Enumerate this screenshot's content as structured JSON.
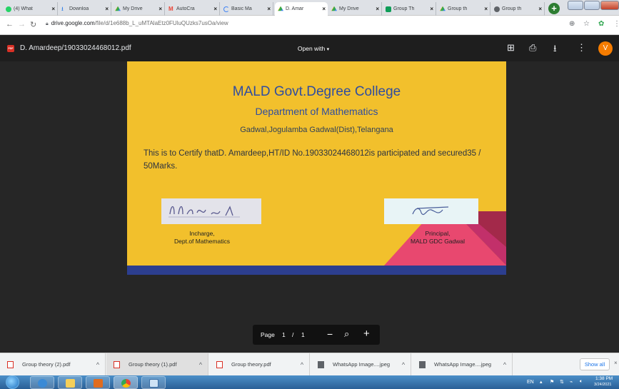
{
  "browser": {
    "tabs": [
      {
        "label": "(4) What",
        "icon_color": "#25d366",
        "active": false
      },
      {
        "label": "Downloa",
        "icon_color": "#1a73e8",
        "active": false
      },
      {
        "label": "My Drive",
        "icon_color": "#fbbc04",
        "active": false
      },
      {
        "label": "AutoCra",
        "icon_color": "#ea4335",
        "active": false
      },
      {
        "label": "Basic Ma",
        "icon_color": "#4285f4",
        "active": false
      },
      {
        "label": "D. Amar",
        "icon_color": "#fbbc04",
        "active": true
      },
      {
        "label": "My Drive",
        "icon_color": "#fbbc04",
        "active": false
      },
      {
        "label": "Group Th",
        "icon_color": "#0f9d58",
        "active": false
      },
      {
        "label": "Group th",
        "icon_color": "#fbbc04",
        "active": false
      },
      {
        "label": "Group th",
        "icon_color": "#5f6368",
        "active": false
      },
      {
        "label": "Group th",
        "icon_color": "#fbbc04",
        "active": false
      }
    ],
    "tab_close_glyph": "×",
    "new_tab_glyph": "+",
    "url_host": "drive.google.com",
    "url_path": "/file/d/1e688b_L_uMTAlaEtz0FUluQUzks7usOa/view"
  },
  "viewer": {
    "filename": "D. Amardeep/19033024468012.pdf",
    "open_with": "Open with",
    "avatar_letter": "V",
    "pdf_badge": "PDF"
  },
  "certificate": {
    "college": "MALD Govt.Degree College",
    "department": "Department of Mathematics",
    "address": "Gadwal,Jogulamba Gadwal(Dist),Telangana",
    "body": "This is to Certify thatD. Amardeep,HT/ID No.19033024468012is participated and secured35 / 50Marks.",
    "incharge_line1": "Incharge,",
    "incharge_line2": "Dept.of Mathematics",
    "principal_line1": "Principal,",
    "principal_line2": "MALD GDC Gadwal"
  },
  "page_control": {
    "page_label": "Page",
    "current_page": "1",
    "separator": "/",
    "total_pages": "1"
  },
  "downloads": {
    "items": [
      {
        "label": "Group theory (2).pdf",
        "type": "pdf"
      },
      {
        "label": "Group theory (1).pdf",
        "type": "pdf"
      },
      {
        "label": "Group theory.pdf",
        "type": "pdf"
      },
      {
        "label": "WhatsApp Image....jpeg",
        "type": "image"
      },
      {
        "label": "WhatsApp Image....jpeg",
        "type": "image"
      }
    ],
    "show_all": "Show all",
    "close_glyph": "×"
  },
  "taskbar": {
    "language": "EN",
    "time": "1:38 PM",
    "date": "3/24/2021"
  },
  "colors": {
    "certificate_bg": "#f2c02c",
    "certificate_title": "#2f4da0",
    "certificate_band": "#2c3e8f",
    "viewer_bg": "#262626",
    "avatar": "#f57c00",
    "pdf_badge": "#d93025"
  }
}
